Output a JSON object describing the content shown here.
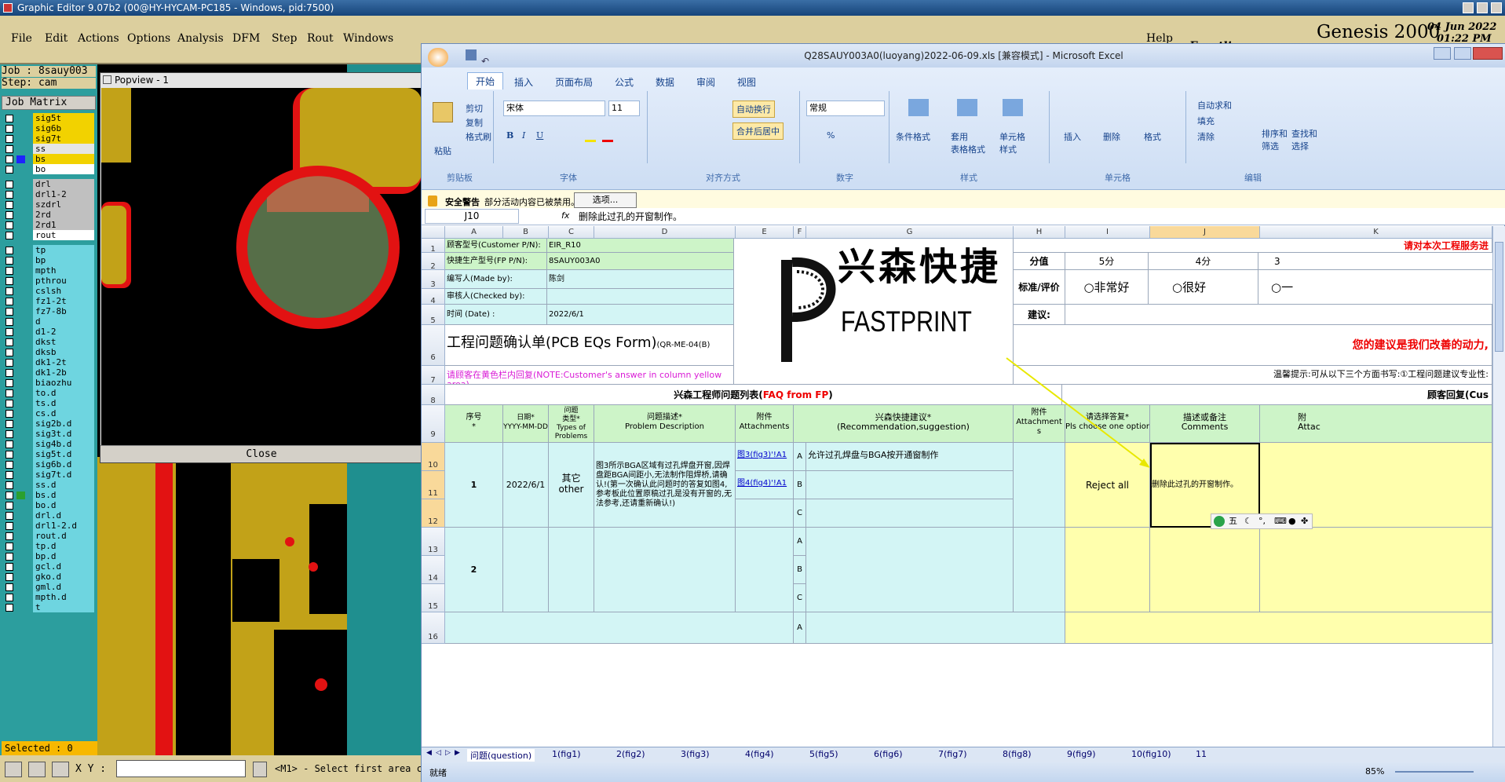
{
  "genesis": {
    "title": "Graphic Editor 9.07b2 (00@HY-HYCAM-PC185 - Windows, pid:7500)",
    "menu": [
      "File",
      "Edit",
      "Actions",
      "Options",
      "Analysis",
      "DFM",
      "Step",
      "Rout",
      "Windows"
    ],
    "help": "Help",
    "brand": "Frontline",
    "product": "Genesis 2000",
    "date": "04 Jun 2022",
    "time": "01:22 PM",
    "job": "Job : 8sauy003",
    "step": "Step: cam",
    "job_matrix": "Job Matrix",
    "layers": [
      "sig5t",
      "sig6b",
      "sig7t",
      "ss",
      "bs",
      "bo",
      "drl",
      "drl1-2",
      "szdrl",
      "2rd",
      "2rd1",
      "rout",
      "tp",
      "bp",
      "mpth",
      "pthrou",
      "cslsh",
      "fz1-2t",
      "fz7-8b",
      "d",
      "d1-2",
      "dkst",
      "dksb",
      "dk1-2t",
      "dk1-2b",
      "biaozhu",
      "to.d",
      "ts.d",
      "cs.d",
      "sig2b.d",
      "sig3t.d",
      "sig4b.d",
      "sig5t.d",
      "sig6b.d",
      "sig7t.d",
      "ss.d",
      "bs.d",
      "bo.d",
      "drl.d",
      "drl1-2.d",
      "rout.d",
      "tp.d",
      "bp.d",
      "gcl.d",
      "gko.d",
      "gml.d",
      "mpth.d",
      "t"
    ],
    "selected": "Selected : 0",
    "xy_label": "X Y :",
    "prompt": "<M1> - Select first area c",
    "popview": {
      "title": "Popview - 1",
      "close": "Close"
    }
  },
  "excel": {
    "title": "Q28SAUY003A0(luoyang)2022-06-09.xls  [兼容模式] - Microsoft Excel",
    "tabs": [
      "开始",
      "插入",
      "页面布局",
      "公式",
      "数据",
      "审阅",
      "视图"
    ],
    "clipboard": {
      "paste": "粘贴",
      "cut": "剪切",
      "copy": "复制",
      "format": "格式刷",
      "cap": "剪贴板"
    },
    "font": {
      "name": "宋体",
      "size": "11",
      "cap": "字体"
    },
    "align": {
      "wrap": "自动换行",
      "merge": "合并后居中",
      "cap": "对齐方式"
    },
    "number": {
      "fmt": "常规",
      "cap": "数字"
    },
    "styles": {
      "cond": "条件格式",
      "table": "套用\n表格格式",
      "cellstyle": "单元格\n样式",
      "cap": "样式"
    },
    "cells": {
      "insert": "插入",
      "delete": "删除",
      "format": "格式",
      "cap": "单元格"
    },
    "editing": {
      "sum": "自动求和",
      "fill": "填充",
      "clear": "清除",
      "sort": "排序和\n筛选",
      "find": "查找和\n选择",
      "cap": "编辑"
    },
    "security": {
      "label": "安全警告",
      "msg": "部分活动内容已被禁用。",
      "btn": "选项..."
    },
    "namebox": "J10",
    "formula": "删除此过孔的开窗制作。",
    "cols": [
      "A",
      "B",
      "C",
      "D",
      "E",
      "F",
      "G",
      "H",
      "I",
      "J",
      "K"
    ],
    "rows": [
      "1",
      "2",
      "3",
      "4",
      "5",
      "6",
      "7",
      "8",
      "9",
      "10",
      "11",
      "12",
      "13",
      "14",
      "15",
      "16"
    ],
    "form": {
      "cust_pn_l": "顾客型号(Customer P/N):",
      "cust_pn": "EIR_R10",
      "fp_pn_l": "快捷生产型号(FP P/N):",
      "fp_pn": "8SAUY003A0",
      "made_l": "编写人(Made by):",
      "made": "陈剑",
      "checked_l": "审核人(Checked by):",
      "date_l": "时间 (Date) :",
      "date": "2022/6/1",
      "title": "工程问题确认单(PCB EQs Form)",
      "code": "(QR-ME-04(B)",
      "note": "请顾客在黄色栏内回复(NOTE:Customer's answer in column yellow area)",
      "logo_cn": "兴森快捷",
      "logo_en": "FASTPRINT",
      "rate_head": "请对本次工程服务进",
      "score_l": "分值",
      "s5": "5分",
      "s4": "4分",
      "s3": "3",
      "eval_l": "标准/评价",
      "e5": "○非常好",
      "e4": "○很好",
      "e3": "○一",
      "suggest_l": "建议:",
      "thanks": "您的建议是我们改善的动力,",
      "tip": "温馨提示:可从以下三个方面书写:①工程问题建议专业性:",
      "list_title": "兴森工程师问题列表(",
      "faq": "FAQ from FP",
      "close_paren": ")",
      "reply_title": "顾客回复(Cus",
      "h_no": "序号\n*",
      "h_date": "日期*\nYYYY-MM-DD",
      "h_type": "问题\n类型*\nTypes of\nProblems",
      "h_desc": "问题描述*\nProblem Description",
      "h_att": "附件\nAttachments",
      "h_sugg": "兴森快捷建议*\n(Recommendation,suggestion)",
      "h_att2": "附件\nAttachment\ns",
      "h_choose": "请选择答复*\nPls choose one option",
      "h_comm": "描述或备注\nComments",
      "h_att3": "附\nAttac",
      "no1": "1",
      "date1": "2022/6/1",
      "type1": "其它\nother",
      "desc1": "图3所示BGA区域有过孔焊盘开窗,因焊盘距BGA间距小,无法制作阻焊桥,请确认!(第一次确认此问题时的答复如图4,参考板此位置原稿过孔是没有开窗的,无法参考,还请重新确认!)",
      "att1a": "图3(fig3)'!A1",
      "att1b": "图4(fig4)'!A1",
      "optA": "A",
      "optB": "B",
      "optC": "C",
      "sugg1": "允许过孔焊盘与BGA按开通窗制作",
      "reply1": "Reject all",
      "comment1": "删除此过孔的开窗制作。",
      "no2": "2"
    },
    "sheets": [
      "问题(question)",
      "1(fig1)",
      "2(fig2)",
      "3(fig3)",
      "4(fig4)",
      "5(fig5)",
      "6(fig6)",
      "7(fig7)",
      "8(fig8)",
      "9(fig9)",
      "10(fig10)",
      "11"
    ],
    "status": "就绪",
    "zoom": "85%",
    "ime": "五"
  }
}
